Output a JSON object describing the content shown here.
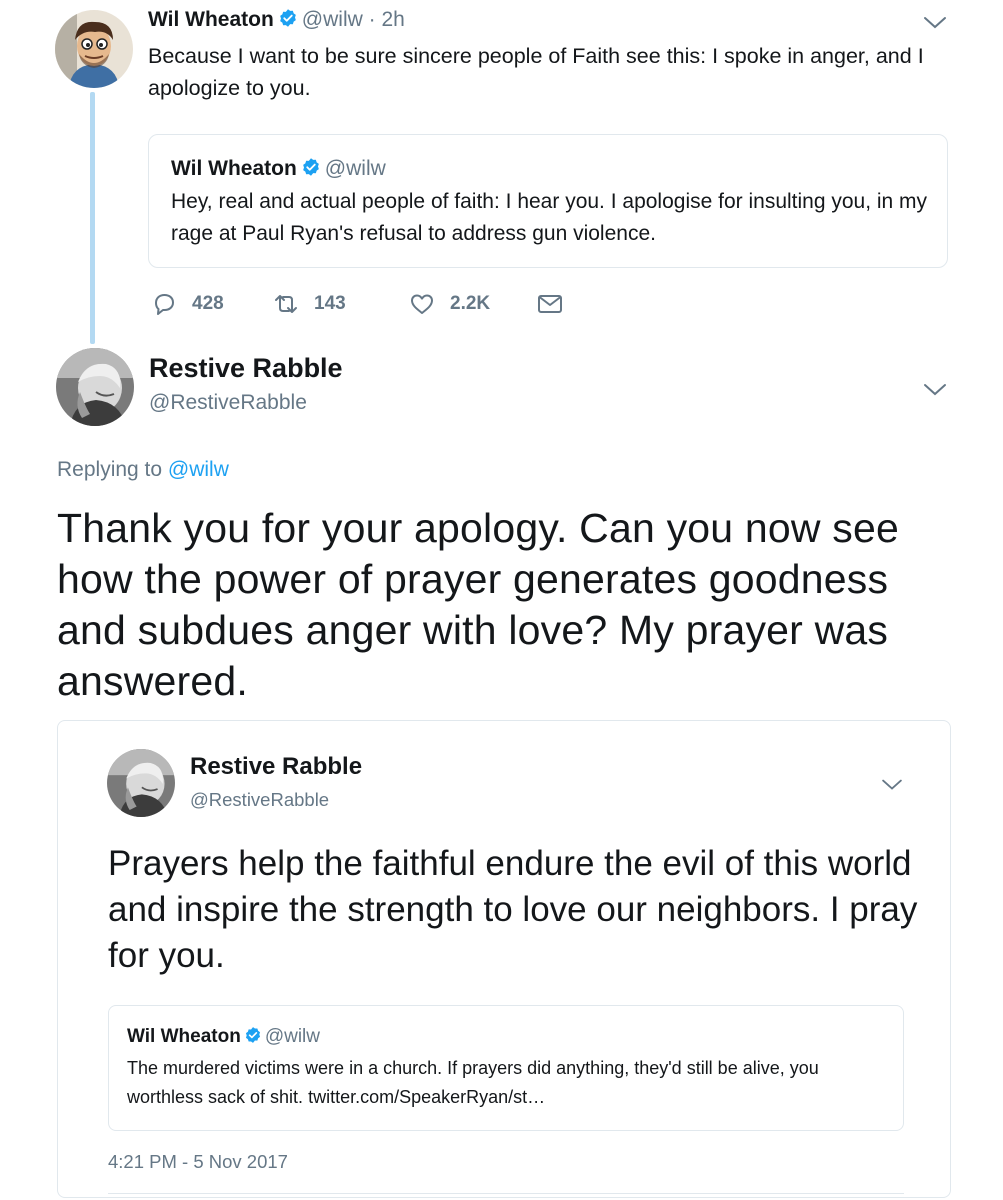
{
  "tweet1": {
    "author_name": "Wil Wheaton",
    "author_handle": "@wilw",
    "time": "· 2h",
    "text": "Because I want to be sure sincere people of Faith see this: I spoke in anger, and I apologize to you.",
    "quoted": {
      "author_name": "Wil Wheaton",
      "author_handle": "@wilw",
      "text": "Hey, real and actual people of faith: I hear you. I apologise for insulting you, in my rage at Paul Ryan's refusal to address gun violence."
    },
    "actions": {
      "replies": "428",
      "retweets": "143",
      "likes": "2.2K"
    }
  },
  "reply": {
    "author_name": "Restive Rabble",
    "author_handle": "@RestiveRabble",
    "replying_prefix": "Replying to",
    "replying_to": "@wilw",
    "text": "Thank you for your apology. Can you now see how the power of prayer generates goodness and subdues anger with love? My prayer was answered."
  },
  "embedded": {
    "author_name": "Restive Rabble",
    "author_handle": "@RestiveRabble",
    "text": "Prayers help the faithful endure the evil of this world and inspire the strength to love our neighbors. I pray for you.",
    "quoted": {
      "author_name": "Wil Wheaton",
      "author_handle": "@wilw",
      "text": "The murdered victims were in a church. If prayers did anything, they'd still be alive, you worthless sack of shit. twitter.com/SpeakerRyan/st…"
    },
    "timestamp": "4:21 PM - 5 Nov 2017"
  },
  "colors": {
    "link": "#1da1f2",
    "secondary": "#657786",
    "border": "#e1e8ed",
    "thread_line": "#b3d9f2"
  },
  "icons": [
    "verified-badge-icon",
    "chevron-down-icon",
    "reply-icon",
    "retweet-icon",
    "like-icon",
    "direct-message-icon"
  ]
}
